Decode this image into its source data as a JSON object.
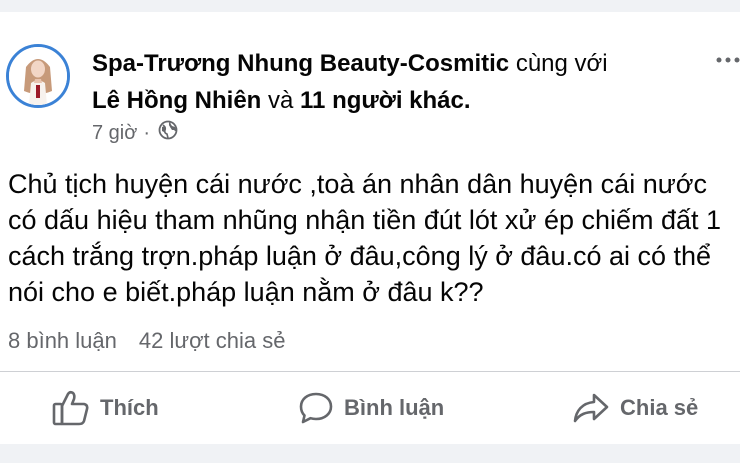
{
  "post": {
    "author": "Spa-Trương Nhung Beauty-Cosmitic",
    "with_word": "cùng với",
    "tagged": "Lê Hồng Nhiên",
    "and_word": "và",
    "others": "11 người khác",
    "others_suffix": ".",
    "time": "7 giờ",
    "separator": "·",
    "privacy_icon": "globe-icon",
    "more_icon": "more-options-icon",
    "content_lines": [
      "Chủ tịch huyện cái nước ,toà án nhân dân huyện cái nước",
      "có dấu hiệu tham nhũng nhận tiền đút lót xử ép chiếm đất 1",
      "cách trắng trợn.pháp luận ở đâu,công lý ở đâu.có ai có thể",
      "nói cho e biết.pháp luận nằm ở đâu k??"
    ],
    "comments_count": "8 bình luận",
    "shares_count": "42 lượt chia sẻ"
  },
  "actions": {
    "like_label": "Thích",
    "comment_label": "Bình luận",
    "share_label": "Chia sẻ"
  },
  "colors": {
    "text": "#050505",
    "secondary_text": "#65676b",
    "background": "#f0f2f5",
    "avatar_ring": "#3b82d6"
  }
}
